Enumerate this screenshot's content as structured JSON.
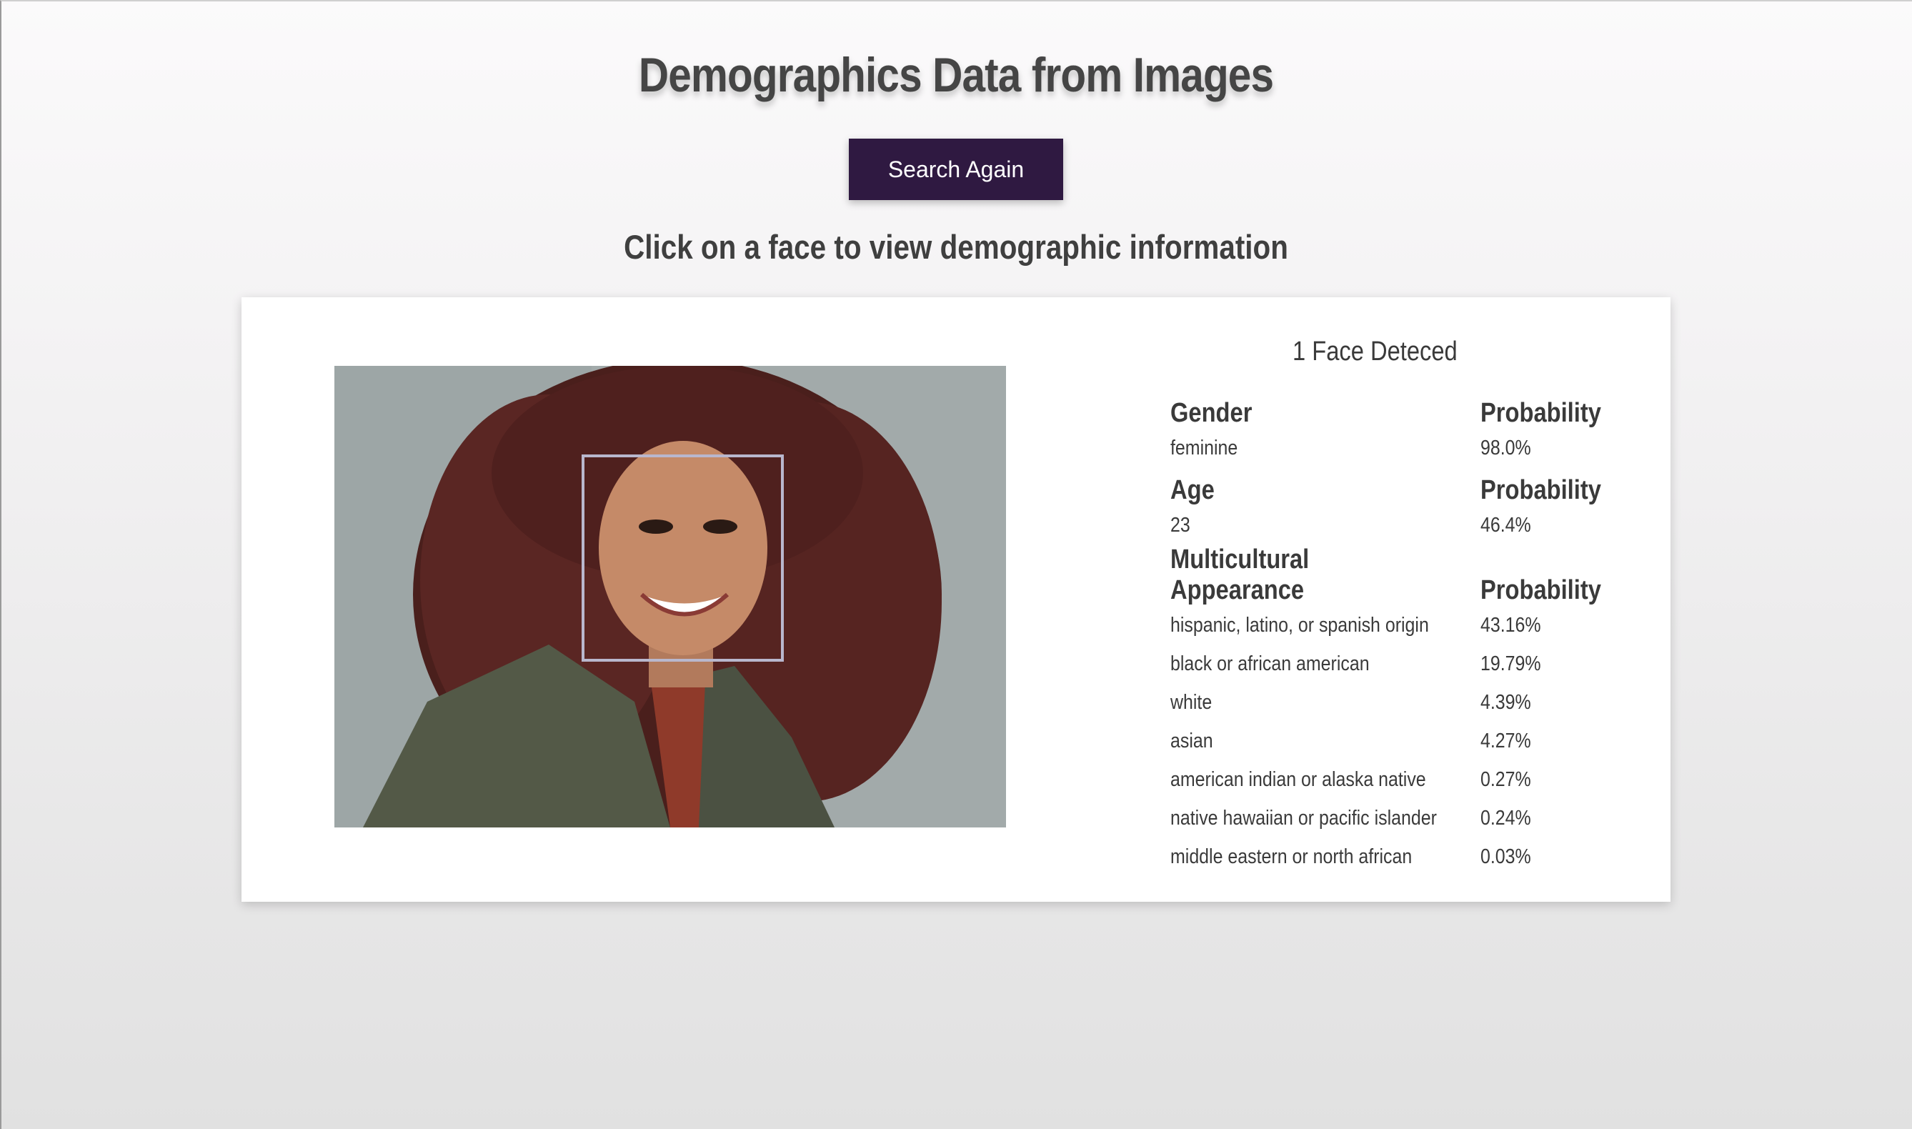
{
  "page": {
    "title": "Demographics Data from Images",
    "search_button": "Search Again",
    "instruction": "Click on a face to view demographic information"
  },
  "results": {
    "faces_detected": "1 Face Deteced",
    "gender": {
      "header": "Gender",
      "prob_header": "Probability",
      "rows": [
        {
          "label": "feminine",
          "value": "98.0%"
        }
      ]
    },
    "age": {
      "header": "Age",
      "prob_header": "Probability",
      "rows": [
        {
          "label": "23",
          "value": "46.4%"
        }
      ]
    },
    "multicultural": {
      "header": "Multicultural Appearance",
      "prob_header": "Probability",
      "rows": [
        {
          "label": "hispanic, latino, or spanish origin",
          "value": "43.16%"
        },
        {
          "label": "black or african american",
          "value": "19.79%"
        },
        {
          "label": "white",
          "value": "4.39%"
        },
        {
          "label": "asian",
          "value": "4.27%"
        },
        {
          "label": "american indian or alaska native",
          "value": "0.27%"
        },
        {
          "label": "native hawaiian or pacific islander",
          "value": "0.24%"
        },
        {
          "label": "middle eastern or north african",
          "value": "0.03%"
        }
      ]
    }
  },
  "colors": {
    "button_bg": "#2f1941",
    "face_box": "#b9b7cd",
    "text": "#3a3a3a"
  }
}
